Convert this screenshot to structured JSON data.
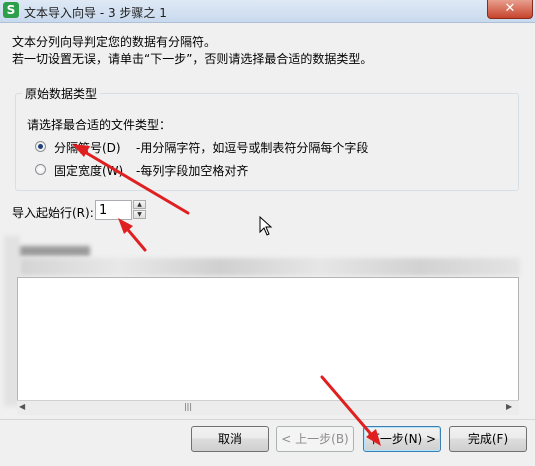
{
  "window": {
    "title": "文本导入向导 - 3 步骤之 1",
    "logo_glyph": "S",
    "close_glyph": "✕",
    "accent": "#2e9e4a"
  },
  "intro": {
    "line1": "文本分列向导判定您的数据有分隔符。",
    "line2": "若一切设置无误，请单击“下一步”，否则请选择最合适的数据类型。"
  },
  "group": {
    "legend": "原始数据类型",
    "prompt": "请选择最合适的文件类型：",
    "options": [
      {
        "label": "分隔符号(D)",
        "desc": "-用分隔字符，如逗号或制表符分隔每个字段",
        "checked": true
      },
      {
        "label": "固定宽度(W)",
        "desc": "-每列字段加空格对齐",
        "checked": false
      }
    ]
  },
  "start_row": {
    "label": "导入起始行(R):",
    "value": "1",
    "up_glyph": "▲",
    "down_glyph": "▼"
  },
  "preview": {
    "scroll_left_glyph": "◀",
    "scroll_right_glyph": "▶",
    "scroll_thumb_glyph": "|||"
  },
  "buttons": {
    "cancel": "取消",
    "back": "< 上一步(B)",
    "next": "下一步(N) >",
    "finish": "完成(F)"
  },
  "annotations": {
    "arrow_color": "#e02020"
  }
}
